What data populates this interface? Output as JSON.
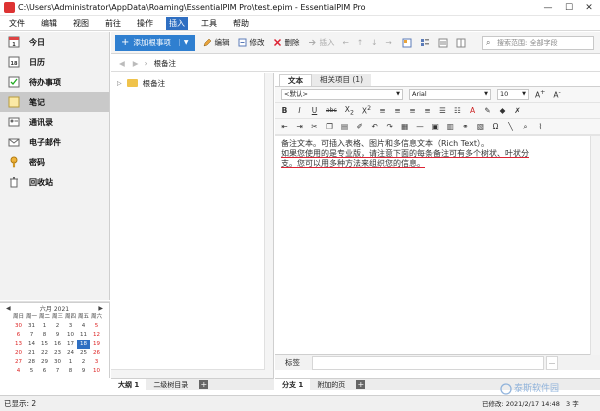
{
  "window": {
    "title": "C:\\Users\\Administrator\\AppData\\Roaming\\EssentialPIM Pro\\test.epim - EssentialPIM Pro",
    "min_label": "—",
    "max_label": "☐",
    "close_label": "✕"
  },
  "menu": [
    "文件",
    "编辑",
    "视图",
    "前往",
    "操作",
    "插入",
    "工具",
    "帮助"
  ],
  "active_menu_index": 5,
  "sidebar": {
    "items": [
      {
        "label": "今日",
        "icon": "today-icon"
      },
      {
        "label": "日历",
        "icon": "calendar-icon"
      },
      {
        "label": "待办事项",
        "icon": "tasks-icon"
      },
      {
        "label": "笔记",
        "icon": "notes-icon"
      },
      {
        "label": "通讯录",
        "icon": "contacts-icon"
      },
      {
        "label": "电子邮件",
        "icon": "email-icon"
      },
      {
        "label": "密码",
        "icon": "key-icon"
      },
      {
        "label": "回收站",
        "icon": "trash-icon"
      }
    ],
    "active_index": 3
  },
  "calendar": {
    "month_label": "六月  2021",
    "weekdays": [
      "周日",
      "周一",
      "周二",
      "周三",
      "周四",
      "周五",
      "周六"
    ],
    "days": [
      "30",
      "31",
      "1",
      "2",
      "3",
      "4",
      "5",
      "6",
      "7",
      "8",
      "9",
      "10",
      "11",
      "12",
      "13",
      "14",
      "15",
      "16",
      "17",
      "18",
      "19",
      "20",
      "21",
      "22",
      "23",
      "24",
      "25",
      "26",
      "27",
      "28",
      "29",
      "30",
      "1",
      "2",
      "3",
      "4",
      "5",
      "6",
      "7",
      "8",
      "9",
      "10"
    ],
    "today": "18"
  },
  "toolbar": {
    "add_label": "添加根事项",
    "edit_label": "编辑",
    "modify_label": "修改",
    "delete_label": "删除",
    "insert_label": "插入",
    "search_placeholder": "搜索范围: 全部字段"
  },
  "breadcrumb": "根备注",
  "tree": {
    "root_label": "根备注"
  },
  "tree_tabs": [
    "大纲 1",
    "二级树目录"
  ],
  "editor": {
    "tabs": [
      "文本",
      "相关项目 (1)"
    ],
    "style_value": "<默认>",
    "font_value": "Arial",
    "size_value": "10",
    "text_lines": [
      "备注文本。可插入表格、图片和多信息文本（Rich Text）。",
      "如果您使用的是专业版，请注意下面的每条备注可有多个树状、叶状分",
      "支。您可以用多种方法来组织您的信息。"
    ],
    "labels_caption": "标签",
    "bottom_tabs": [
      "分支 1",
      "附加的页"
    ]
  },
  "status": {
    "left": "已显示: 2",
    "mid": "已修改: 2021/2/17 14:48",
    "right": "3 字"
  },
  "watermark": "泰斯软件园"
}
